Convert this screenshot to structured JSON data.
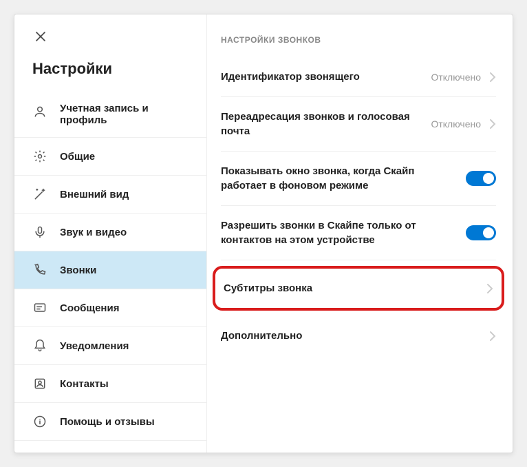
{
  "sidebar": {
    "title": "Настройки",
    "items": [
      {
        "label": "Учетная запись и профиль"
      },
      {
        "label": "Общие"
      },
      {
        "label": "Внешний вид"
      },
      {
        "label": "Звук и видео"
      },
      {
        "label": "Звонки"
      },
      {
        "label": "Сообщения"
      },
      {
        "label": "Уведомления"
      },
      {
        "label": "Контакты"
      },
      {
        "label": "Помощь и отзывы"
      }
    ]
  },
  "content": {
    "section_title": "НАСТРОЙКИ ЗВОНКОВ",
    "rows": [
      {
        "label": "Идентификатор звонящего",
        "value": "Отключено"
      },
      {
        "label": "Переадресация звонков и голосовая почта",
        "value": "Отключено"
      },
      {
        "label": "Показывать окно звонка, когда Скайп работает в фоновом режиме"
      },
      {
        "label": "Разрешить звонки в Скайпе только от контактов на этом устройстве"
      },
      {
        "label": "Субтитры звонка"
      },
      {
        "label": "Дополнительно"
      }
    ]
  }
}
